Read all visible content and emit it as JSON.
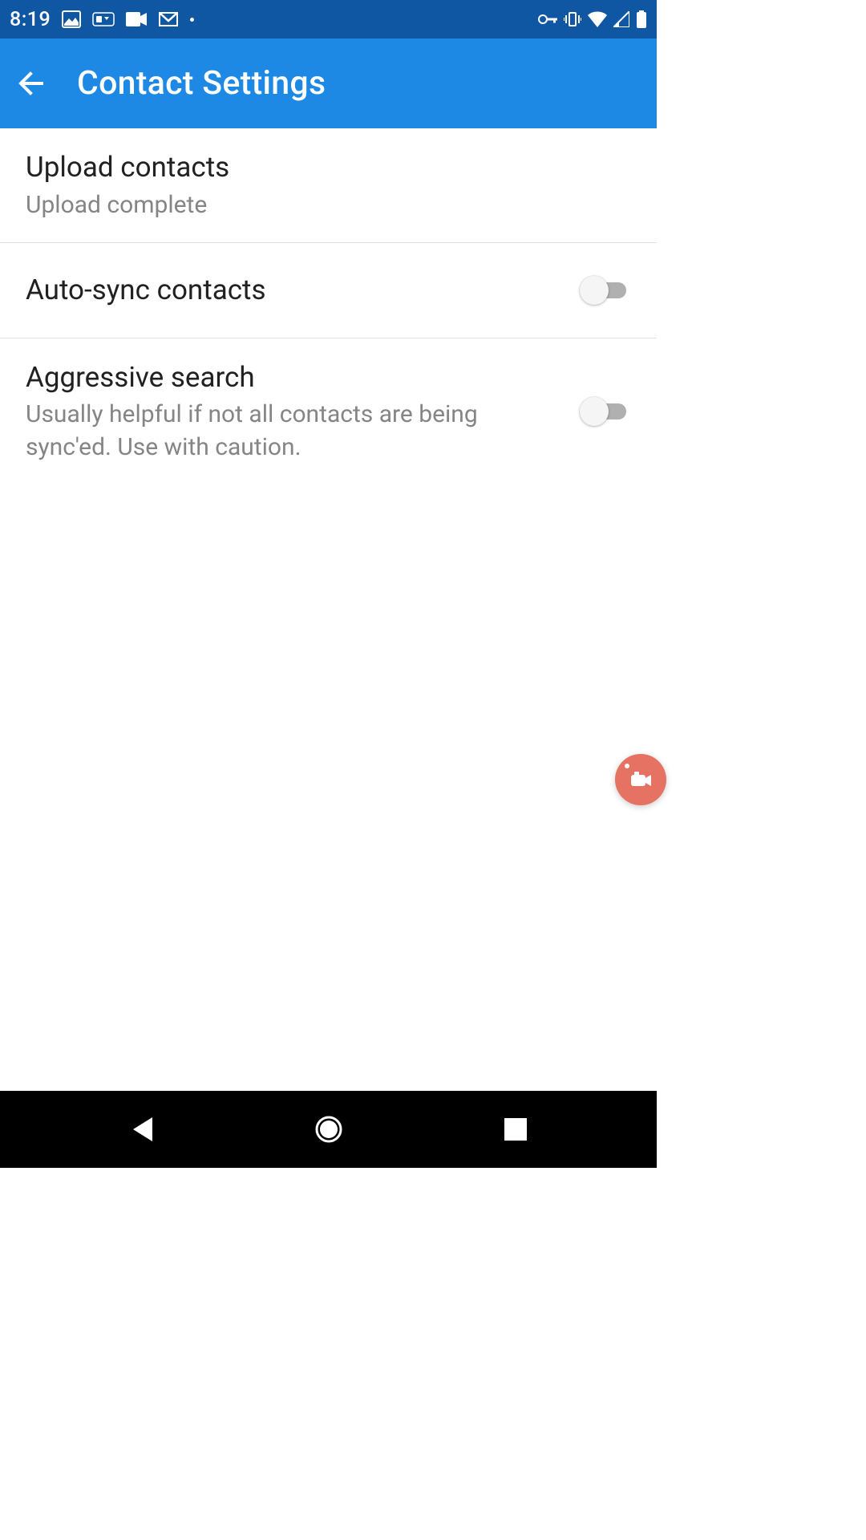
{
  "status_bar": {
    "time": "8:19"
  },
  "app_bar": {
    "title": "Contact Settings"
  },
  "settings": {
    "upload": {
      "title": "Upload contacts",
      "subtitle": "Upload complete"
    },
    "auto_sync": {
      "title": "Auto-sync contacts"
    },
    "aggressive": {
      "title": "Aggressive search",
      "subtitle": "Usually helpful if not all contacts are being sync'ed. Use with caution."
    }
  },
  "colors": {
    "status_bar": "#0f56a3",
    "app_bar": "#1e88e5",
    "accent_fab": "#e57263"
  }
}
